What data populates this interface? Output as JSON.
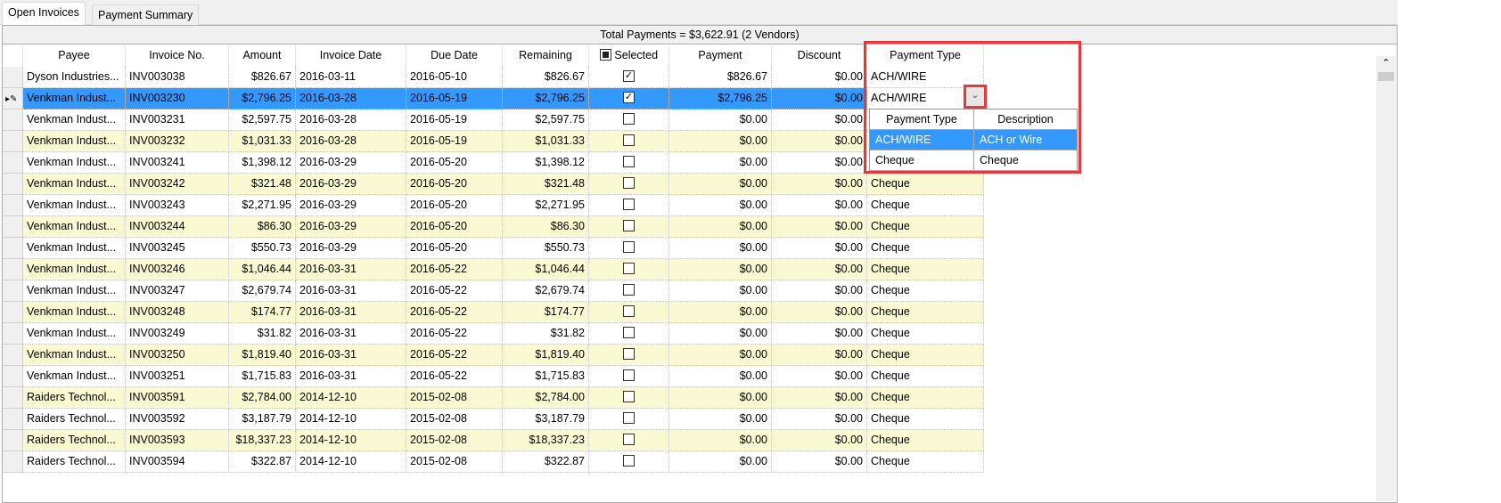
{
  "tabs": [
    {
      "label": "Open Invoices",
      "active": true
    },
    {
      "label": "Payment Summary",
      "active": false
    }
  ],
  "total_label": "Total Payments = $3,622.91 (2 Vendors)",
  "columns": [
    "Payee",
    "Invoice No.",
    "Amount",
    "Invoice Date",
    "Due Date",
    "Remaining",
    "Selected",
    "Payment",
    "Discount",
    "Payment Type"
  ],
  "rows": [
    {
      "payee": "Dyson Industries...",
      "invoice": "INV003038",
      "amount": "$826.67",
      "inv_date": "2016-03-11",
      "due": "2016-05-10",
      "remaining": "$826.67",
      "selected": true,
      "payment": "$826.67",
      "discount": "$0.00",
      "type": "ACH/WIRE"
    },
    {
      "payee": "Venkman  Indust...",
      "invoice": "INV003230",
      "amount": "$2,796.25",
      "inv_date": "2016-03-28",
      "due": "2016-05-19",
      "remaining": "$2,796.25",
      "selected": true,
      "payment": "$2,796.25",
      "discount": "$0.00",
      "type": "ACH/WIRE"
    },
    {
      "payee": "Venkman  Indust...",
      "invoice": "INV003231",
      "amount": "$2,597.75",
      "inv_date": "2016-03-28",
      "due": "2016-05-19",
      "remaining": "$2,597.75",
      "selected": false,
      "payment": "$0.00",
      "discount": "$0.00",
      "type": ""
    },
    {
      "payee": "Venkman  Indust...",
      "invoice": "INV003232",
      "amount": "$1,031.33",
      "inv_date": "2016-03-28",
      "due": "2016-05-19",
      "remaining": "$1,031.33",
      "selected": false,
      "payment": "$0.00",
      "discount": "$0.00",
      "type": ""
    },
    {
      "payee": "Venkman  Indust...",
      "invoice": "INV003241",
      "amount": "$1,398.12",
      "inv_date": "2016-03-29",
      "due": "2016-05-20",
      "remaining": "$1,398.12",
      "selected": false,
      "payment": "$0.00",
      "discount": "$0.00",
      "type": ""
    },
    {
      "payee": "Venkman  Indust...",
      "invoice": "INV003242",
      "amount": "$321.48",
      "inv_date": "2016-03-29",
      "due": "2016-05-20",
      "remaining": "$321.48",
      "selected": false,
      "payment": "$0.00",
      "discount": "$0.00",
      "type": "Cheque"
    },
    {
      "payee": "Venkman  Indust...",
      "invoice": "INV003243",
      "amount": "$2,271.95",
      "inv_date": "2016-03-29",
      "due": "2016-05-20",
      "remaining": "$2,271.95",
      "selected": false,
      "payment": "$0.00",
      "discount": "$0.00",
      "type": "Cheque"
    },
    {
      "payee": "Venkman  Indust...",
      "invoice": "INV003244",
      "amount": "$86.30",
      "inv_date": "2016-03-29",
      "due": "2016-05-20",
      "remaining": "$86.30",
      "selected": false,
      "payment": "$0.00",
      "discount": "$0.00",
      "type": "Cheque"
    },
    {
      "payee": "Venkman  Indust...",
      "invoice": "INV003245",
      "amount": "$550.73",
      "inv_date": "2016-03-29",
      "due": "2016-05-20",
      "remaining": "$550.73",
      "selected": false,
      "payment": "$0.00",
      "discount": "$0.00",
      "type": "Cheque"
    },
    {
      "payee": "Venkman  Indust...",
      "invoice": "INV003246",
      "amount": "$1,046.44",
      "inv_date": "2016-03-31",
      "due": "2016-05-22",
      "remaining": "$1,046.44",
      "selected": false,
      "payment": "$0.00",
      "discount": "$0.00",
      "type": "Cheque"
    },
    {
      "payee": "Venkman  Indust...",
      "invoice": "INV003247",
      "amount": "$2,679.74",
      "inv_date": "2016-03-31",
      "due": "2016-05-22",
      "remaining": "$2,679.74",
      "selected": false,
      "payment": "$0.00",
      "discount": "$0.00",
      "type": "Cheque"
    },
    {
      "payee": "Venkman  Indust...",
      "invoice": "INV003248",
      "amount": "$174.77",
      "inv_date": "2016-03-31",
      "due": "2016-05-22",
      "remaining": "$174.77",
      "selected": false,
      "payment": "$0.00",
      "discount": "$0.00",
      "type": "Cheque"
    },
    {
      "payee": "Venkman  Indust...",
      "invoice": "INV003249",
      "amount": "$31.82",
      "inv_date": "2016-03-31",
      "due": "2016-05-22",
      "remaining": "$31.82",
      "selected": false,
      "payment": "$0.00",
      "discount": "$0.00",
      "type": "Cheque"
    },
    {
      "payee": "Venkman  Indust...",
      "invoice": "INV003250",
      "amount": "$1,819.40",
      "inv_date": "2016-03-31",
      "due": "2016-05-22",
      "remaining": "$1,819.40",
      "selected": false,
      "payment": "$0.00",
      "discount": "$0.00",
      "type": "Cheque"
    },
    {
      "payee": "Venkman  Indust...",
      "invoice": "INV003251",
      "amount": "$1,715.83",
      "inv_date": "2016-03-31",
      "due": "2016-05-22",
      "remaining": "$1,715.83",
      "selected": false,
      "payment": "$0.00",
      "discount": "$0.00",
      "type": "Cheque"
    },
    {
      "payee": "Raiders Technol...",
      "invoice": "INV003591",
      "amount": "$2,784.00",
      "inv_date": "2014-12-10",
      "due": "2015-02-08",
      "remaining": "$2,784.00",
      "selected": false,
      "payment": "$0.00",
      "discount": "$0.00",
      "type": "Cheque"
    },
    {
      "payee": "Raiders Technol...",
      "invoice": "INV003592",
      "amount": "$3,187.79",
      "inv_date": "2014-12-10",
      "due": "2015-02-08",
      "remaining": "$3,187.79",
      "selected": false,
      "payment": "$0.00",
      "discount": "$0.00",
      "type": "Cheque"
    },
    {
      "payee": "Raiders Technol...",
      "invoice": "INV003593",
      "amount": "$18,337.23",
      "inv_date": "2014-12-10",
      "due": "2015-02-08",
      "remaining": "$18,337.23",
      "selected": false,
      "payment": "$0.00",
      "discount": "$0.00",
      "type": "Cheque"
    },
    {
      "payee": "Raiders Technol...",
      "invoice": "INV003594",
      "amount": "$322.87",
      "inv_date": "2014-12-10",
      "due": "2015-02-08",
      "remaining": "$322.87",
      "selected": false,
      "payment": "$0.00",
      "discount": "$0.00",
      "type": "Cheque"
    }
  ],
  "dropdown": {
    "headers": [
      "Payment Type",
      "Description"
    ],
    "options": [
      {
        "type": "ACH/WIRE",
        "desc": "ACH or Wire",
        "highlighted": true
      },
      {
        "type": "Cheque",
        "desc": "Cheque",
        "highlighted": false
      }
    ]
  },
  "colors": {
    "selection": "#3399ff",
    "alt_row": "#fafad2",
    "highlight_box": "#e8383d"
  }
}
